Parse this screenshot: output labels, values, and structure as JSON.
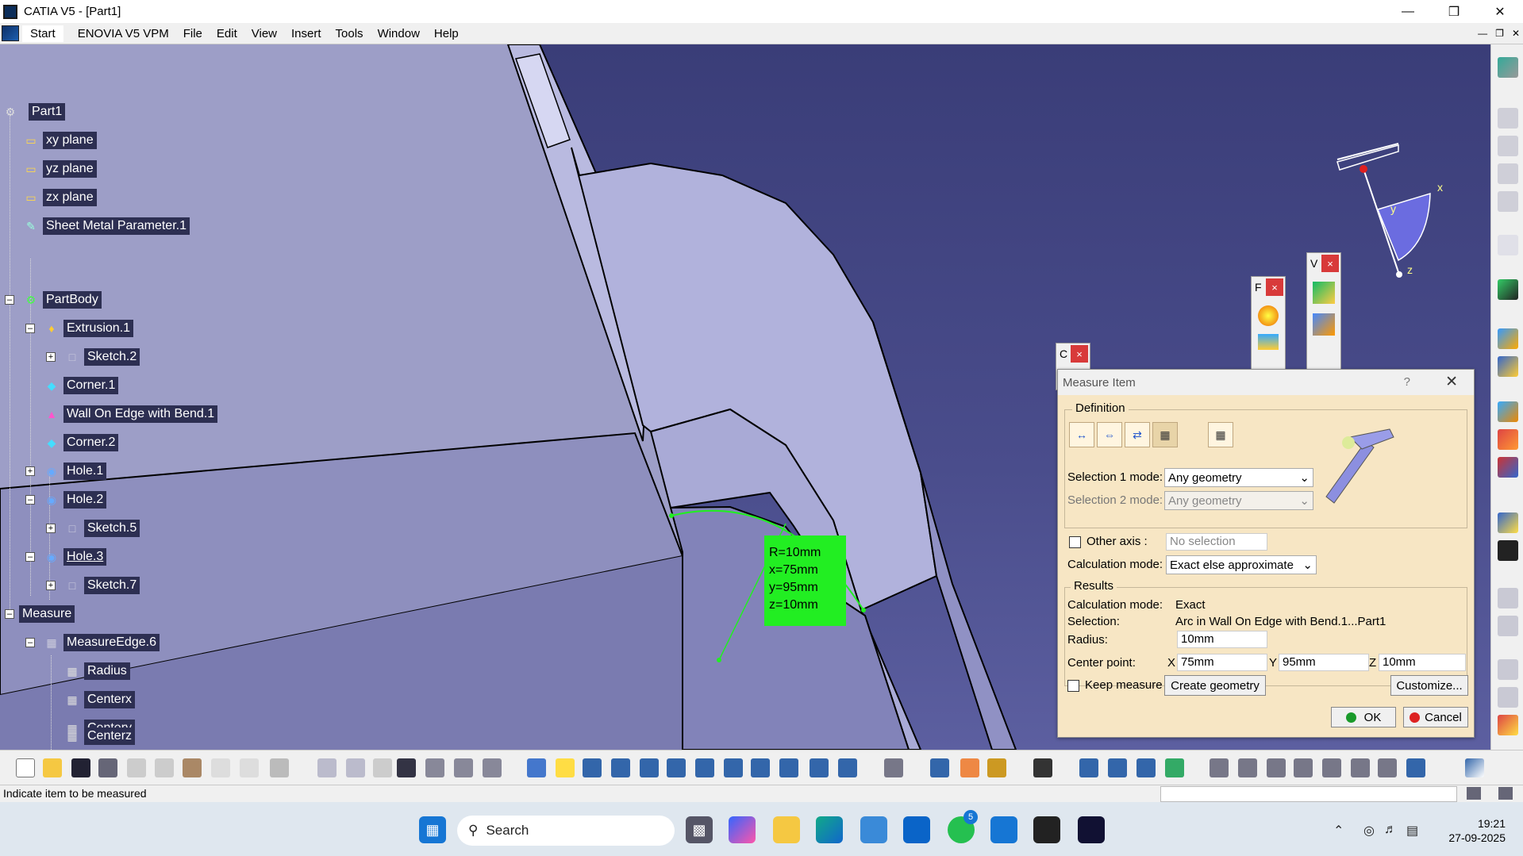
{
  "window": {
    "title": "CATIA V5 - [Part1]",
    "min": "—",
    "max": "❒",
    "close": "✕"
  },
  "menu": {
    "start": "Start",
    "items": [
      "ENOVIA V5 VPM",
      "File",
      "Edit",
      "View",
      "Insert",
      "Tools",
      "Window",
      "Help"
    ]
  },
  "tree": [
    {
      "label": "Part1",
      "icon": "part-icon"
    },
    {
      "label": "xy plane",
      "icon": "plane-icon"
    },
    {
      "label": "yz plane",
      "icon": "plane-icon"
    },
    {
      "label": "zx plane",
      "icon": "plane-icon"
    },
    {
      "label": "Sheet Metal Parameter.1",
      "icon": "sheet-metal-icon"
    },
    {
      "label": "PartBody",
      "icon": "partbody-icon"
    },
    {
      "label": "Extrusion.1",
      "icon": "extrusion-icon"
    },
    {
      "label": "Sketch.2",
      "icon": "sketch-icon"
    },
    {
      "label": "Corner.1",
      "icon": "corner-icon"
    },
    {
      "label": "Wall On Edge with Bend.1",
      "icon": "wall-icon"
    },
    {
      "label": "Corner.2",
      "icon": "corner-icon"
    },
    {
      "label": "Hole.1",
      "icon": "hole-icon"
    },
    {
      "label": "Hole.2",
      "icon": "hole-icon"
    },
    {
      "label": "Sketch.5",
      "icon": "sketch-icon"
    },
    {
      "label": "Hole.3",
      "icon": "hole-icon"
    },
    {
      "label": "Sketch.7",
      "icon": "sketch-icon"
    },
    {
      "label": "Measure",
      "icon": ""
    },
    {
      "label": "MeasureEdge.6",
      "icon": "measure-edge-icon"
    },
    {
      "label": "Radius",
      "icon": "parameter-icon"
    },
    {
      "label": "Centerx",
      "icon": "parameter-icon"
    },
    {
      "label": "Centery",
      "icon": "parameter-icon"
    },
    {
      "label": "Centerz",
      "icon": "parameter-icon"
    }
  ],
  "measure_label": {
    "r": "R=10mm",
    "x": "x=75mm",
    "y": "y=95mm",
    "z": "z=10mm"
  },
  "compass": {
    "x": "x",
    "y": "y",
    "z": "z"
  },
  "floating_toolbars": {
    "a": "C",
    "b": "F",
    "c": "V",
    "close": "×"
  },
  "dialog": {
    "title": "Measure Item",
    "help": "?",
    "close": "✕",
    "definition": "Definition",
    "sel1_label": "Selection 1 mode:",
    "sel1_value": "Any geometry",
    "sel2_label": "Selection 2 mode:",
    "sel2_value": "Any geometry",
    "other_axis": "Other axis :",
    "no_selection": "No selection",
    "calc_label": "Calculation mode:",
    "calc_value": "Exact else approximate",
    "results": "Results",
    "res_calc_label": "Calculation mode:",
    "res_calc_value": "Exact",
    "selection_label": "Selection:",
    "selection_value": "Arc in Wall On Edge with Bend.1...Part1",
    "radius_label": "Radius:",
    "radius_value": "10mm",
    "center_label": "Center point:",
    "cx_label": "X",
    "cx_value": "75mm",
    "cy_label": "Y",
    "cy_value": "95mm",
    "cz_label": "Z",
    "cz_value": "10mm",
    "keep_measure": "Keep measure",
    "create_geometry": "Create geometry",
    "customize": "Customize...",
    "ok": "OK",
    "cancel": "Cancel"
  },
  "status": {
    "text": "Indicate item to be measured"
  },
  "taskbar": {
    "search": "Search",
    "time": "19:21",
    "date": "27-09-2025",
    "whatsapp_badge": "5"
  },
  "colors": {
    "background": "#3a3b72",
    "dialog": "#f7e6c4",
    "measure_label": "#22ee22",
    "accent_close": "#d83a3a"
  }
}
